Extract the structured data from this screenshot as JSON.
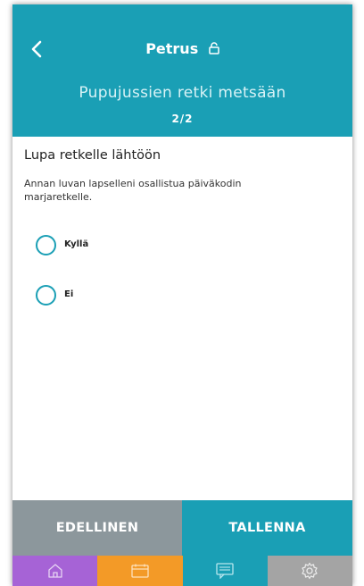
{
  "header": {
    "child_name": "Petrus",
    "trip_title": "Pupujussien retki metsään",
    "page_indicator": "2/2"
  },
  "question": {
    "title": "Lupa retkelle lähtöön",
    "description": "Annan luvan lapselleni osallistua päiväkodin marjaretkelle."
  },
  "options": [
    {
      "label": "Kyllä",
      "selected": false
    },
    {
      "label": "Ei",
      "selected": false
    }
  ],
  "buttons": {
    "previous": "EDELLINEN",
    "save": "TALLENNA"
  },
  "bottom_nav": [
    {
      "icon": "home-icon",
      "color": "#a663d6"
    },
    {
      "icon": "calendar-icon",
      "color": "#f39a27"
    },
    {
      "icon": "messages-icon",
      "color": "#1a9fb5"
    },
    {
      "icon": "settings-icon",
      "color": "#a4a4a4"
    }
  ],
  "colors": {
    "accent": "#1a9fb5",
    "button_secondary": "#8c979c"
  }
}
